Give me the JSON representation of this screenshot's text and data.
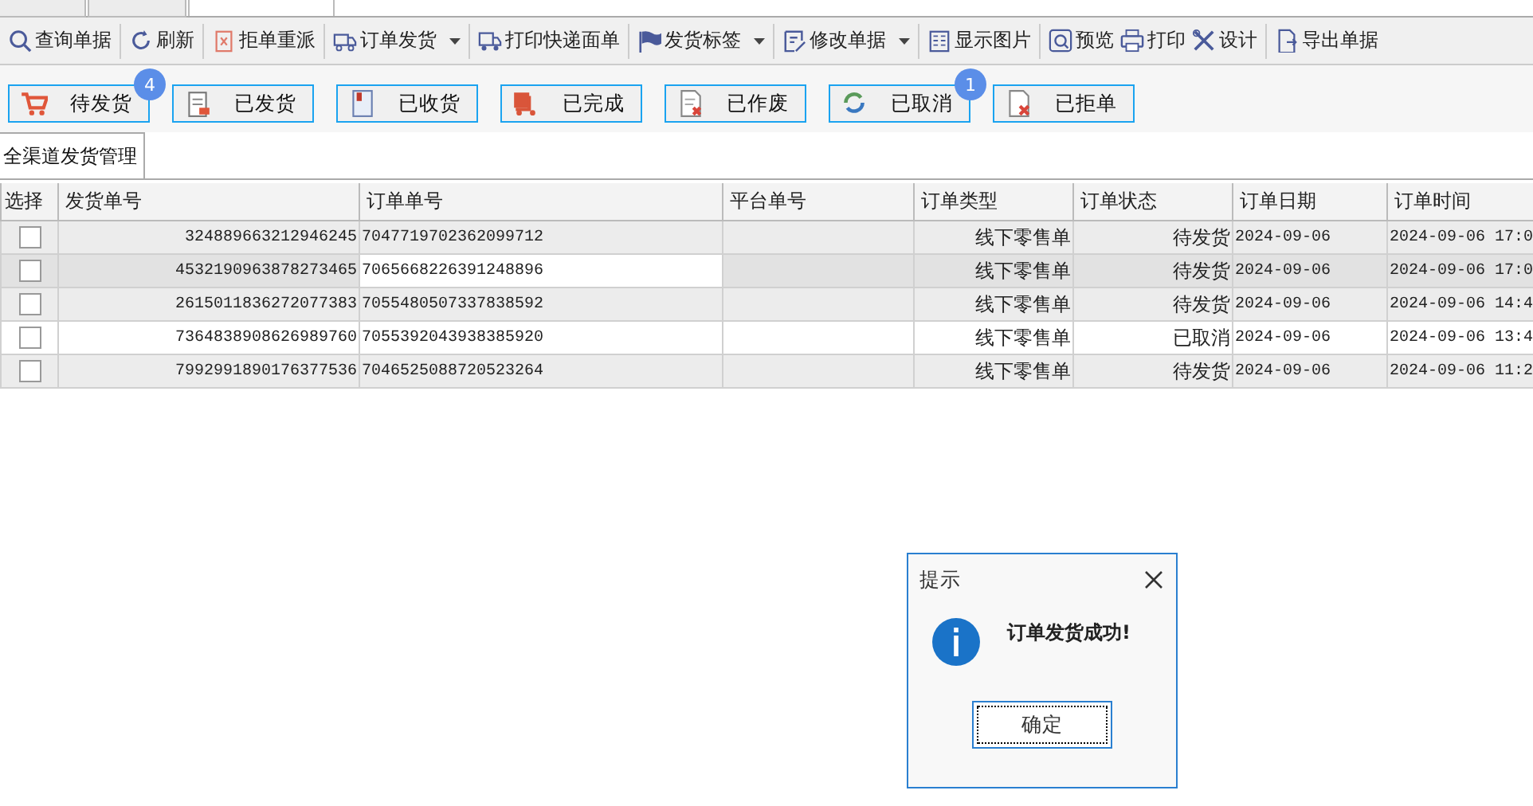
{
  "top_tabs": [
    {
      "selected": false
    },
    {
      "selected": false
    },
    {
      "selected": true
    }
  ],
  "toolbar_groups": [
    {
      "items": [
        {
          "label": "查询单据",
          "dropdown": false
        }
      ]
    },
    {
      "items": [
        {
          "label": "刷新",
          "dropdown": false
        }
      ]
    },
    {
      "items": [
        {
          "label": "拒单重派",
          "dropdown": false
        }
      ]
    },
    {
      "items": [
        {
          "label": "订单发货",
          "dropdown": true
        }
      ]
    },
    {
      "items": [
        {
          "label": "打印快递面单",
          "dropdown": false
        }
      ]
    },
    {
      "items": [
        {
          "label": "发货标签",
          "dropdown": true
        }
      ]
    },
    {
      "items": [
        {
          "label": "修改单据",
          "dropdown": true
        }
      ]
    },
    {
      "items": [
        {
          "label": "显示图片",
          "dropdown": false
        }
      ]
    },
    {
      "items": [
        {
          "label": "预览",
          "dropdown": false
        },
        {
          "label": "打印",
          "dropdown": false
        },
        {
          "label": "设计",
          "dropdown": false
        }
      ]
    },
    {
      "items": [
        {
          "label": "导出单据",
          "dropdown": false
        }
      ]
    }
  ],
  "status_buttons": [
    {
      "label": "待发货",
      "badge": "4"
    },
    {
      "label": "已发货"
    },
    {
      "label": "已收货"
    },
    {
      "label": "已完成"
    },
    {
      "label": "已作废"
    },
    {
      "label": "已取消",
      "badge": "1"
    },
    {
      "label": "已拒单"
    }
  ],
  "page_tab": {
    "label": "全渠道发货管理",
    "selected": true
  },
  "table": {
    "columns": [
      "选择",
      "发货单号",
      "订单单号",
      "平台单号",
      "订单类型",
      "订单状态",
      "订单日期",
      "订单时间"
    ],
    "rows": [
      {
        "checked": false,
        "selected": false,
        "cells": [
          "",
          "324889663212946245",
          "7047719702362099712",
          "",
          "线下零售单",
          "待发货",
          "2024-09-06",
          "2024-09-06 17:0"
        ]
      },
      {
        "checked": false,
        "selected": true,
        "cells": [
          "",
          "4532190963878273465",
          "7065668226391248896",
          "",
          "线下零售单",
          "待发货",
          "2024-09-06",
          "2024-09-06 17:0"
        ]
      },
      {
        "checked": false,
        "selected": false,
        "cells": [
          "",
          "2615011836272077383",
          "7055480507337838592",
          "",
          "线下零售单",
          "待发货",
          "2024-09-06",
          "2024-09-06 14:4"
        ]
      },
      {
        "checked": false,
        "selected": false,
        "cells": [
          "",
          "7364838908626989760",
          "7055392043938385920",
          "",
          "线下零售单",
          "已取消",
          "2024-09-06",
          "2024-09-06 13:4"
        ]
      },
      {
        "checked": false,
        "selected": false,
        "cells": [
          "",
          "7992991890176377536",
          "7046525088720523264",
          "",
          "线下零售单",
          "待发货",
          "2024-09-06",
          "2024-09-06 11:2"
        ]
      }
    ]
  },
  "dialog": {
    "title": "提示",
    "message": "订单发货成功!",
    "button": "确定"
  }
}
